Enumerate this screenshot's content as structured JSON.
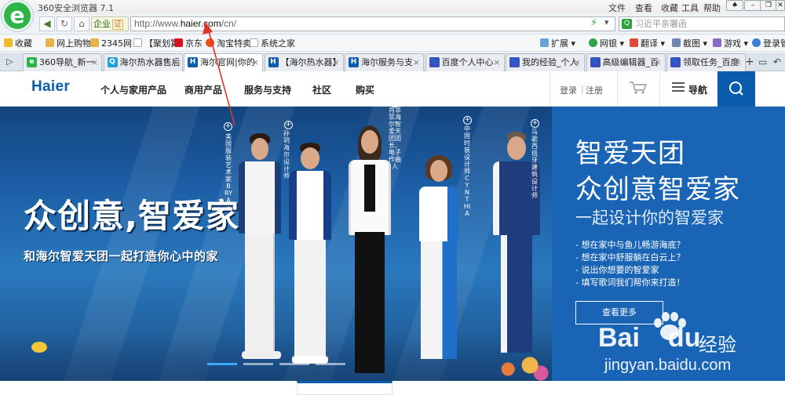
{
  "browser": {
    "title": "360安全浏览器 7.1",
    "logo": "e",
    "menus": [
      "文件",
      "查看",
      "收藏",
      "工具",
      "帮助"
    ],
    "nav_icons": [
      "back-icon",
      "forward-icon",
      "refresh-icon",
      "home-icon"
    ],
    "enterprise_label": "企业",
    "cert_label": "证",
    "url_prefix": "http://www.",
    "url_domain": "haier.com",
    "url_path": "/cn/",
    "search_placeholder": "习近平亲署函",
    "favorites_left": [
      "收藏",
      "网上购物",
      "2345网",
      "【聚划算",
      "京东",
      "淘宝特卖",
      "系统之家"
    ],
    "favorites_right": [
      "扩展",
      "网银",
      "翻译",
      "截图",
      "游戏",
      "登录管家"
    ],
    "tabs": [
      {
        "label": "360导航_新一",
        "color": "#2fb44a",
        "glyph": "e"
      },
      {
        "label": "海尔热水器售后",
        "color": "#24a0d8",
        "glyph": "Q"
      },
      {
        "label": "海尔官网|你的",
        "color": "#0b5cac",
        "glyph": "H"
      },
      {
        "label": "【海尔热水器】",
        "color": "#0b5cac",
        "glyph": "H"
      },
      {
        "label": "海尔服务与支",
        "color": "#0b5cac",
        "glyph": "H"
      },
      {
        "label": "百度个人中心",
        "color": "#3c4fbf",
        "glyph": "🐾"
      },
      {
        "label": "我的经验_个人",
        "color": "#3c4fbf",
        "glyph": "🐾"
      },
      {
        "label": "高级编辑器_百",
        "color": "#3c4fbf",
        "glyph": "🐾"
      },
      {
        "label": "领取任务_百度",
        "color": "#3c4fbf",
        "glyph": "🐾"
      }
    ]
  },
  "site": {
    "logo": "Haier",
    "nav": [
      "个人与家用产品",
      "商用产品",
      "服务与支持",
      "社区",
      "购买"
    ],
    "login": "登录",
    "divider": "|",
    "register": "注册",
    "guide": "导航"
  },
  "banner": {
    "slogan": "众创意,智爱家",
    "subline": "和海尔智爱天团一起打造你心中的家",
    "person_labels": [
      "美国服装艺术家BRYAN",
      "孙玥海尔设计师",
      "肖菲菲海尔智爱天团团长、电子作曲人",
      "中国时装设计师CYNTHIA",
      "马歌西班牙建筑设计师"
    ],
    "slides": 4,
    "active_slide": 1
  },
  "panel": {
    "title1": "智爱天团",
    "title2": "众创意智爱家",
    "subtitle": "一起设计你的智爱家",
    "bullets": [
      "- 想在家中与鱼儿畅游海底？",
      "- 想在家中舒服躺在白云上？",
      "- 说出你想要的智爱家",
      "- 填写歌词我们帮你来打造！"
    ],
    "button": "查看更多"
  },
  "watermark": {
    "brand": "Bai",
    "brand2": "du",
    "cn": "经验",
    "url": "jingyan.baidu.com"
  }
}
